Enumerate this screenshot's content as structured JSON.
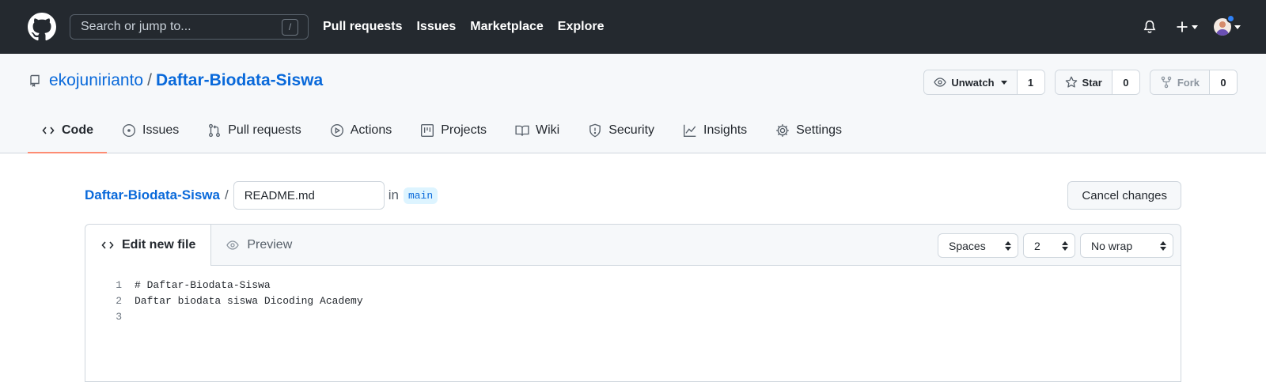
{
  "header": {
    "search_placeholder": "Search or jump to...",
    "search_shortcut": "/",
    "nav": [
      "Pull requests",
      "Issues",
      "Marketplace",
      "Explore"
    ]
  },
  "repo": {
    "owner": "ekojunirianto",
    "separator": "/",
    "name": "Daftar-Biodata-Siswa",
    "watch": {
      "label": "Unwatch",
      "count": "1"
    },
    "star": {
      "label": "Star",
      "count": "0"
    },
    "fork": {
      "label": "Fork",
      "count": "0"
    },
    "tabs": [
      "Code",
      "Issues",
      "Pull requests",
      "Actions",
      "Projects",
      "Wiki",
      "Security",
      "Insights",
      "Settings"
    ],
    "active_tab": "Code"
  },
  "editor": {
    "breadcrumb_repo": "Daftar-Biodata-Siswa",
    "breadcrumb_sep": "/",
    "filename": "README.md",
    "in_label": "in",
    "branch": "main",
    "cancel_label": "Cancel changes",
    "tab_edit": "Edit new file",
    "tab_preview": "Preview",
    "indent_mode": "Spaces",
    "indent_size": "2",
    "wrap_mode": "No wrap",
    "lines": [
      {
        "num": "1",
        "text": "# Daftar-Biodata-Siswa"
      },
      {
        "num": "2",
        "text": "Daftar biodata siswa Dicoding Academy"
      },
      {
        "num": "3",
        "text": ""
      }
    ]
  },
  "colors": {
    "header_bg": "#24292f",
    "link": "#0969da",
    "active_tab_underline": "#fd8c73",
    "notification_dot": "#2f81f7"
  }
}
